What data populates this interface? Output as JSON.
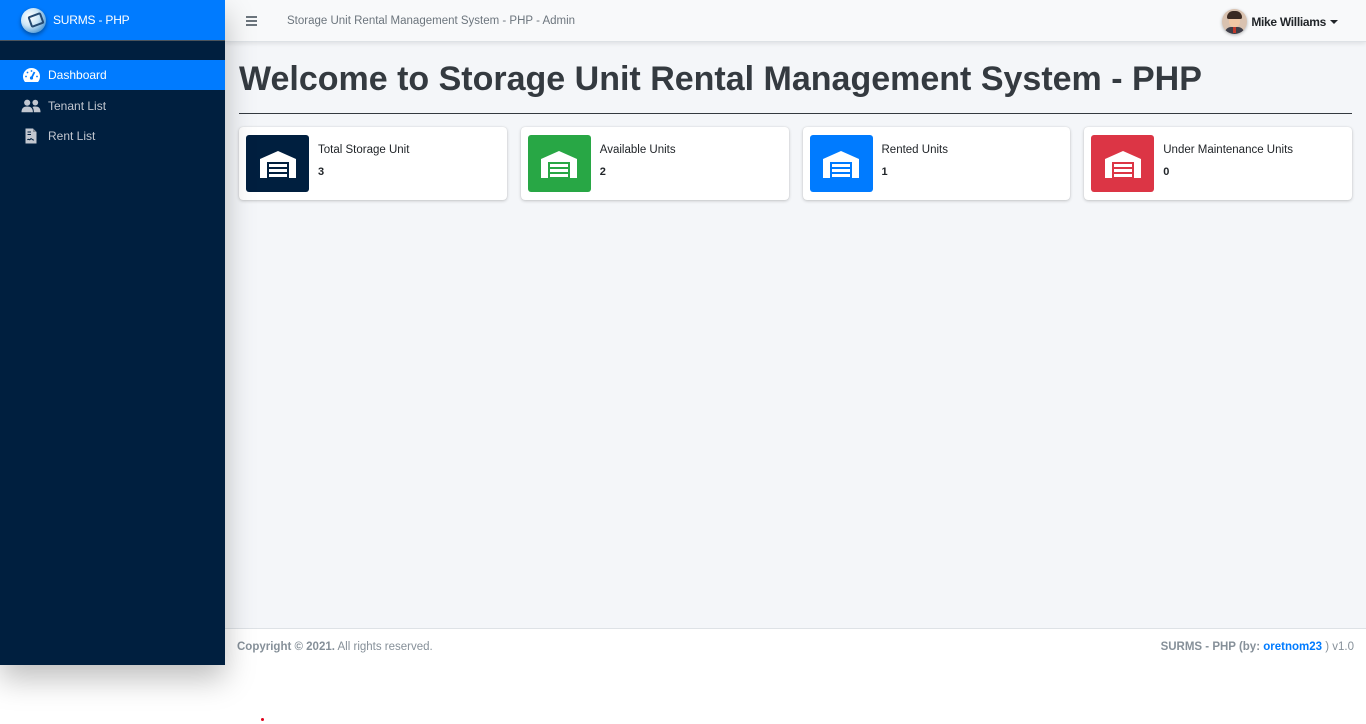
{
  "brand": {
    "name": "SURMS - PHP",
    "logo_icon": "globe-logo-icon"
  },
  "sidebar": {
    "items": [
      {
        "label": "Dashboard",
        "icon": "tachometer-icon",
        "active": true
      },
      {
        "label": "Tenant List",
        "icon": "users-icon",
        "active": false
      },
      {
        "label": "Rent List",
        "icon": "file-contract-icon",
        "active": false
      }
    ]
  },
  "topbar": {
    "menu_icon": "hamburger-icon",
    "title": "Storage Unit Rental Management System - PHP - Admin",
    "user": {
      "name": "Mike Williams",
      "avatar_icon": "user-avatar-icon",
      "dropdown_icon": "caret-down-icon"
    }
  },
  "main": {
    "title": "Welcome to Storage Unit Rental Management System - PHP",
    "cards": [
      {
        "label": "Total Storage Unit",
        "value": "3",
        "icon": "warehouse-icon",
        "color": "#001f3f",
        "stripe": "#001f3f"
      },
      {
        "label": "Available Units",
        "value": "2",
        "icon": "warehouse-icon",
        "color": "#28a745",
        "stripe": "#28a745"
      },
      {
        "label": "Rented Units",
        "value": "1",
        "icon": "warehouse-icon",
        "color": "#007bff",
        "stripe": "#007bff"
      },
      {
        "label": "Under Maintenance Units",
        "value": "0",
        "icon": "warehouse-icon",
        "color": "#dc3545",
        "stripe": "#dc3545"
      }
    ]
  },
  "footer": {
    "copyright_bold": "Copyright © 2021.",
    "copyright_rest": " All rights reserved.",
    "app_by": "SURMS - PHP (by: ",
    "author": "oretnom23",
    "version": " ) v1.0"
  },
  "colors": {
    "primary": "#007bff",
    "sidebar_bg": "#001f3f",
    "success": "#28a745",
    "danger": "#dc3545"
  }
}
